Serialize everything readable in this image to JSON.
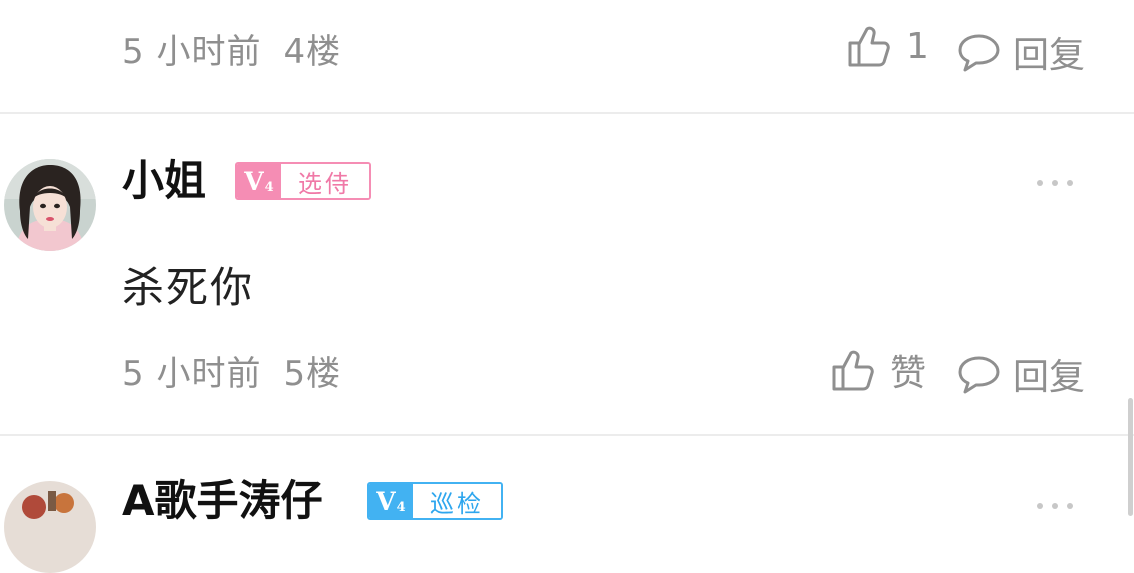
{
  "comments": [
    {
      "time": "5 小时前",
      "floor": "4楼",
      "likes": "1",
      "reply_label": "回复"
    },
    {
      "user": "小姐",
      "level": "V",
      "level_num": "4",
      "badge_text": "选侍",
      "badge_color": "#f58db4",
      "text": "杀死你",
      "time": "5 小时前",
      "floor": "5楼",
      "like_label": "赞",
      "reply_label": "回复"
    },
    {
      "user": "A歌手涛仔",
      "level": "V",
      "level_num": "4",
      "badge_text": "巡检",
      "badge_color": "#42b2f2"
    }
  ]
}
